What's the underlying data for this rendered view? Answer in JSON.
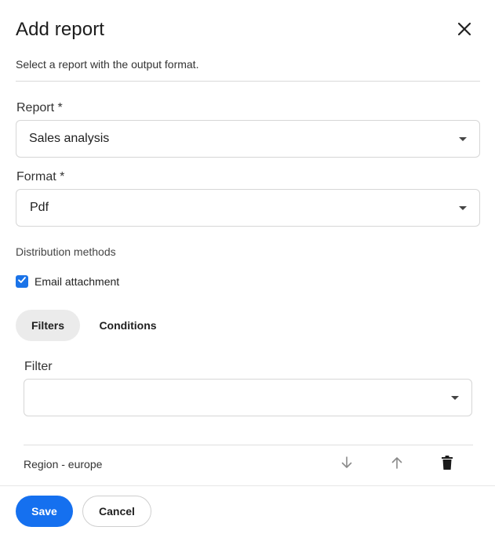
{
  "dialog": {
    "title": "Add report",
    "subtitle": "Select a report with the output format."
  },
  "report_field": {
    "label": "Report *",
    "value": "Sales analysis"
  },
  "format_field": {
    "label": "Format *",
    "value": "Pdf"
  },
  "distribution": {
    "section_label": "Distribution methods",
    "email_attachment": {
      "label": "Email attachment",
      "checked": true
    }
  },
  "tabs": [
    {
      "label": "Filters",
      "active": true
    },
    {
      "label": "Conditions",
      "active": false
    }
  ],
  "filter_field": {
    "label": "Filter",
    "value": ""
  },
  "filters_list": [
    {
      "label": "Region - europe"
    }
  ],
  "footer": {
    "save_label": "Save",
    "cancel_label": "Cancel"
  },
  "colors": {
    "primary": "#1570ef",
    "checkbox": "#1a73e8",
    "active_tab_bg": "#ebebeb"
  },
  "icons": [
    "close-icon",
    "caret-down-icon",
    "check-icon",
    "arrow-down-icon",
    "arrow-up-icon",
    "trash-icon"
  ]
}
